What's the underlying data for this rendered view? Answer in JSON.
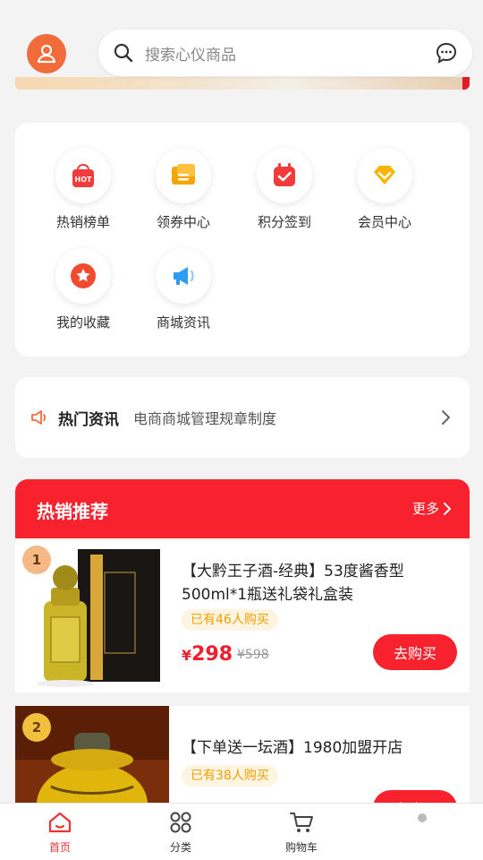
{
  "search": {
    "placeholder": "搜索心仪商品"
  },
  "menu": [
    {
      "label": "热销榜单",
      "icon": "hot-list-icon",
      "color": "#f23b3b"
    },
    {
      "label": "领券中心",
      "icon": "coupon-icon",
      "color": "#f7a600"
    },
    {
      "label": "积分签到",
      "icon": "calendar-checkin-icon",
      "color": "#f23b3b"
    },
    {
      "label": "会员中心",
      "icon": "member-diamond-icon",
      "color": "#f7b500"
    },
    {
      "label": "我的收藏",
      "icon": "favorite-star-icon",
      "color": "#f24a2e"
    },
    {
      "label": "商城资讯",
      "icon": "megaphone-icon",
      "color": "#2f9cf4"
    }
  ],
  "news": {
    "title": "热门资讯",
    "text": "电商商城管理规章制度"
  },
  "hot": {
    "title": "热销推荐",
    "more": "更多",
    "products": [
      {
        "rank": "1",
        "name": "【大黔王子酒-经典】53度酱香型500ml*1瓶送礼袋礼盒装",
        "sold": "已有46人购买",
        "currency": "¥",
        "price": "298",
        "original": "¥598",
        "buy": "去购买"
      },
      {
        "rank": "2",
        "name": "【下单送一坛酒】1980加盟开店",
        "sold": "已有38人购买",
        "currency": "",
        "price": "",
        "original": "",
        "buy": "去购买"
      }
    ]
  },
  "tabs": [
    {
      "label": "首页",
      "icon": "home-icon",
      "active": true
    },
    {
      "label": "分类",
      "icon": "category-grid-icon",
      "active": false
    },
    {
      "label": "购物车",
      "icon": "cart-icon",
      "active": false
    },
    {
      "label": "",
      "icon": "profile-icon",
      "active": false
    }
  ],
  "colors": {
    "primary": "#f8222e",
    "accent_orange": "#f26b3a"
  }
}
